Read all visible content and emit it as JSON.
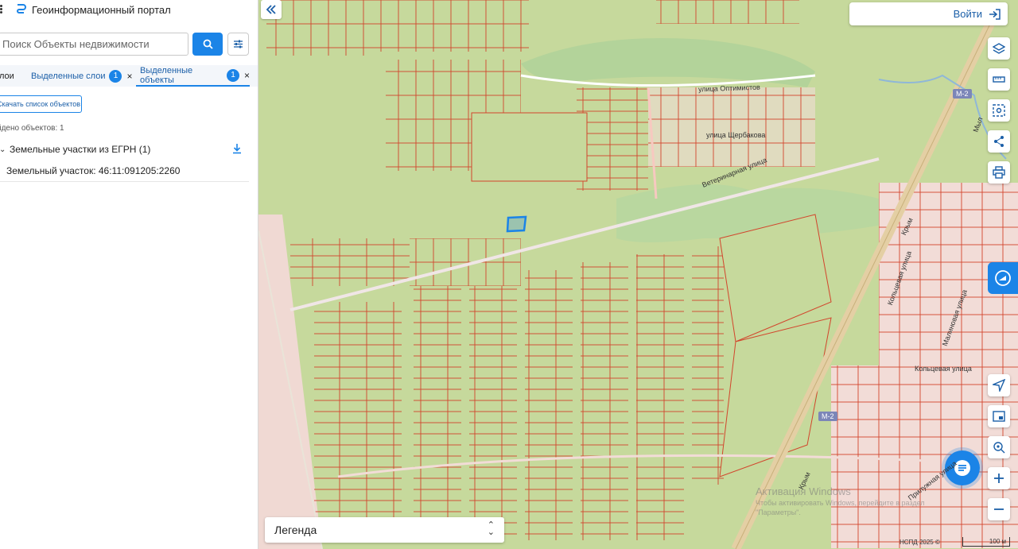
{
  "app": {
    "title": "Геоинформационный портал"
  },
  "search": {
    "placeholder": "Поиск Объекты недвижимости"
  },
  "tabs": [
    {
      "label": "лои"
    },
    {
      "label": "Выделенные слои",
      "badge": "1"
    },
    {
      "label": "Выделенные объекты",
      "badge": "1"
    }
  ],
  "tab_close": "×",
  "results": {
    "download_list_label": "Скачать список объектов",
    "found_text": "йдено объектов: 1",
    "group_title": "Земельные участки из ЕГРН (1)",
    "item_label": "Земельный участок: 46:11:091205:2260"
  },
  "header": {
    "login_label": "Войти"
  },
  "legend": {
    "label": "Легенда"
  },
  "map_labels": {
    "street_optimistov": "улица Оптимистов",
    "street_sherbakova": "улица Щербакова",
    "street_veterinarnaya": "Ветеринарная улица",
    "street_koltsevaya_v": "Кольцевая улица",
    "street_malinovaya": "Малиновая улица",
    "street_koltsevaya_h": "Кольцевая улица",
    "street_krym": "Крым",
    "street_krym2": "Крым",
    "street_prilujnaya": "Прилужная улица",
    "street_maslo": "Мыл",
    "road_badge_1": "М-2",
    "road_badge_2": "М-2"
  },
  "watermark": {
    "title": "Активация Windows",
    "text": "Чтобы активировать Windows, перейдите в раздел \"Параметры\"."
  },
  "attribution": {
    "credit": "НСПД 2025 ©",
    "scale": "100 м"
  },
  "colors": {
    "accent": "#1b84e7",
    "parcel_line": "#d2452c",
    "map_green": "#c6d99c",
    "selected_parcel": "#1b84e7",
    "urban_pink": "#f2dcd7"
  }
}
